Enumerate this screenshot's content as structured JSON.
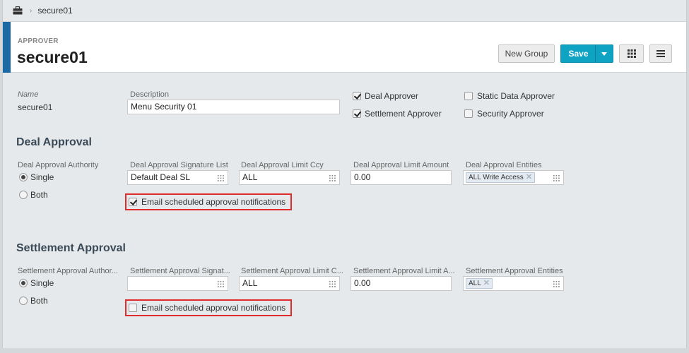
{
  "breadcrumb": {
    "current": "secure01"
  },
  "header": {
    "type_label": "APPROVER",
    "title": "secure01"
  },
  "toolbar": {
    "new_group_label": "New Group",
    "save_label": "Save"
  },
  "general": {
    "name_label": "Name",
    "name_value": "secure01",
    "description_label": "Description",
    "description_value": "Menu Security 01",
    "roles": [
      {
        "label": "Deal Approver",
        "checked": true
      },
      {
        "label": "Settlement Approver",
        "checked": true
      },
      {
        "label": "Static Data Approver",
        "checked": false
      },
      {
        "label": "Security Approver",
        "checked": false
      }
    ]
  },
  "deal": {
    "title": "Deal Approval",
    "authority_label": "Deal Approval Authority",
    "single_label": "Single",
    "both_label": "Both",
    "authority_selected": "Single",
    "sig_list_label": "Deal Approval Signature List",
    "sig_list_value": "Default Deal SL",
    "limit_ccy_label": "Deal Approval Limit Ccy",
    "limit_ccy_value": "ALL",
    "limit_amount_label": "Deal Approval Limit Amount",
    "limit_amount_value": "0.00",
    "entities_label": "Deal Approval Entities",
    "entities_tag": "ALL Write Access",
    "email_label": "Email scheduled approval notifications",
    "email_checked": true
  },
  "settlement": {
    "title": "Settlement Approval",
    "authority_label": "Settlement Approval Author...",
    "single_label": "Single",
    "both_label": "Both",
    "authority_selected": "Single",
    "sig_list_label": "Settlement Approval Signat...",
    "sig_list_value": "",
    "limit_ccy_label": "Settlement Approval Limit C...",
    "limit_ccy_value": "ALL",
    "limit_amount_label": "Settlement Approval Limit A...",
    "limit_amount_value": "0.00",
    "entities_label": "Settlement Approval Entities",
    "entities_tag": "ALL",
    "email_label": "Email scheduled approval notifications",
    "email_checked": false
  },
  "colors": {
    "accent": "#1b6aa5",
    "save": "#0fa3c3",
    "highlight": "#e02b2b"
  },
  "icons": [
    "briefcase-icon",
    "chevron-right-icon",
    "caret-down-icon",
    "grid-icon",
    "menu-icon",
    "remove-tag-icon"
  ]
}
